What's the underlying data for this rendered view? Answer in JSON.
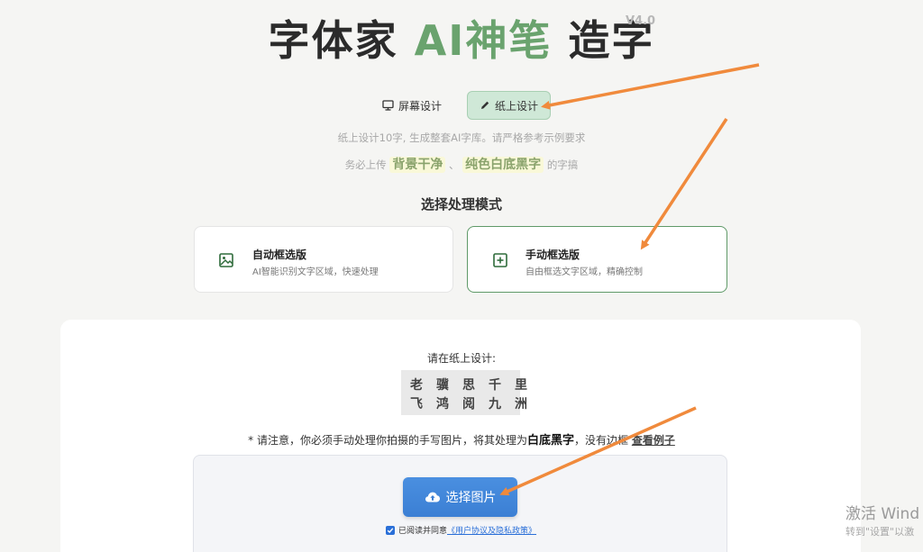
{
  "header": {
    "title_part1": "字体家 ",
    "title_accent": "AI神笔",
    "title_part2": " 造字",
    "version": "V4.0"
  },
  "tabs": [
    {
      "label": "屏幕设计",
      "icon": "monitor-icon",
      "active": false
    },
    {
      "label": "纸上设计",
      "icon": "pencil-icon",
      "active": true
    }
  ],
  "hints": {
    "line1": "纸上设计10字, 生成整套AI字库。请严格参考示例要求",
    "line2_prefix": "务必上传",
    "line2_hl1": "背景干净",
    "line2_sep": "、",
    "line2_hl2": "纯色白底黑字",
    "line2_suffix": "的字搞"
  },
  "mode": {
    "section_title": "选择处理模式",
    "options": [
      {
        "title": "自动框选版",
        "desc": "AI智能识别文字区域，快速处理",
        "icon": "image-icon",
        "selected": false
      },
      {
        "title": "手动框选版",
        "desc": "自由框选文字区域，精确控制",
        "icon": "plus-square-icon",
        "selected": true
      }
    ]
  },
  "upload": {
    "design_label": "请在纸上设计:",
    "sample_row1": [
      "老",
      "骥",
      "思",
      "千",
      "里"
    ],
    "sample_row2": [
      "飞",
      "鸿",
      "阅",
      "九",
      "洲"
    ],
    "notice_prefix": "* 请注意，你必须手动处理你拍摄的手写图片，将其处理为",
    "notice_bold": "白底黑字",
    "notice_mid": "，没有边框",
    "notice_link": "查看例子",
    "button_label": "选择图片",
    "agree_prefix": "已阅读并同意",
    "agree_link": "《用户协议及隐私政策》",
    "agree_checked": true
  },
  "system": {
    "watermark_line1": "激活 Wind",
    "watermark_line2": "转到\"设置\"以激"
  },
  "colors": {
    "accent_green": "#6aa36e",
    "active_tab_bg": "#cfe8d7",
    "upload_blue": "#3b7fd4",
    "arrow_orange": "#f08a3c"
  }
}
